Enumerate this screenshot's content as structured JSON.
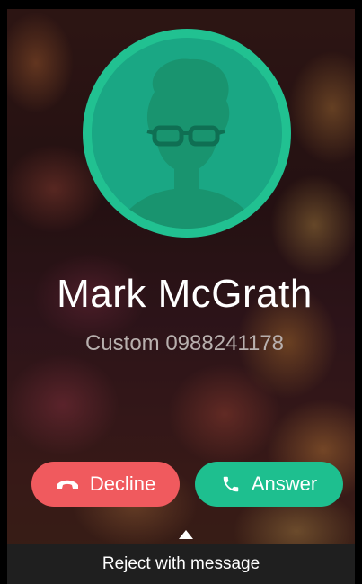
{
  "caller": {
    "name": "Mark McGrath",
    "number": "Custom 0988241178",
    "avatar_icon": "person-glasses-silhouette-icon"
  },
  "actions": {
    "decline_label": "Decline",
    "decline_icon": "phone-hangup-icon",
    "answer_label": "Answer",
    "answer_icon": "phone-icon"
  },
  "reject": {
    "label": "Reject with message",
    "arrow_icon": "triangle-up-icon"
  },
  "colors": {
    "avatar_fill": "#1aa784",
    "avatar_ring": "#21c191",
    "decline": "#f05a5e",
    "answer": "#1ebf8f",
    "reject_bar": "#1f1f1f"
  }
}
